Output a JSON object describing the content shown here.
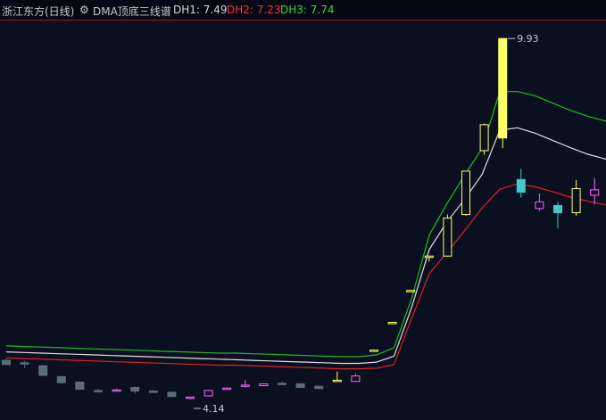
{
  "header": {
    "title": "浙江东方(日线)",
    "gear_icon": "gear-icon",
    "indicator": "DMA顶底三线谱",
    "dh1": "DH1: 7.49",
    "dh2": "DH2: 7.23",
    "dh3": "DH3: 7.74"
  },
  "colors": {
    "background": "#0b1020",
    "up_normal": "#ff66ff",
    "down_normal": "#5a6e78",
    "up_hot": "#ffff66",
    "down_hot": "#44c8c8",
    "dh1_line": "#e0e0e0",
    "dh2_line": "#e02020",
    "dh3_line": "#22bb22"
  },
  "chart_data": {
    "type": "candlestick",
    "ylim": [
      3.6,
      10.2
    ],
    "max_label": "9.93",
    "min_label": "4.14",
    "candles": [
      {
        "o": 4.59,
        "c": 4.52,
        "h": 4.62,
        "l": 4.52,
        "hot": false
      },
      {
        "o": 4.55,
        "c": 4.53,
        "h": 4.58,
        "l": 4.46,
        "hot": false
      },
      {
        "o": 4.5,
        "c": 4.34,
        "h": 4.51,
        "l": 4.33,
        "hot": false
      },
      {
        "o": 4.32,
        "c": 4.22,
        "h": 4.33,
        "l": 4.2,
        "hot": false
      },
      {
        "o": 4.23,
        "c": 4.11,
        "h": 4.24,
        "l": 4.1,
        "hot": false
      },
      {
        "o": 4.09,
        "c": 4.08,
        "h": 4.12,
        "l": 4.07,
        "hot": false
      },
      {
        "o": 4.08,
        "c": 4.1,
        "h": 4.12,
        "l": 4.07,
        "hot": false
      },
      {
        "o": 4.14,
        "c": 4.08,
        "h": 4.16,
        "l": 4.04,
        "hot": false
      },
      {
        "o": 4.08,
        "c": 4.07,
        "h": 4.1,
        "l": 4.05,
        "hot": false
      },
      {
        "o": 4.06,
        "c": 3.99,
        "h": 4.06,
        "l": 3.98,
        "hot": false
      },
      {
        "o": 3.96,
        "c": 3.98,
        "h": 3.98,
        "l": 3.94,
        "hot": false
      },
      {
        "o": 4.0,
        "c": 4.09,
        "h": 4.1,
        "l": 3.99,
        "hot": false
      },
      {
        "o": 4.11,
        "c": 4.13,
        "h": 4.14,
        "l": 4.1,
        "hot": false
      },
      {
        "o": 4.18,
        "c": 4.18,
        "h": 4.26,
        "l": 4.14,
        "hot": false
      },
      {
        "o": 4.17,
        "c": 4.2,
        "h": 4.21,
        "l": 4.16,
        "hot": false
      },
      {
        "o": 4.21,
        "c": 4.2,
        "h": 4.24,
        "l": 4.18,
        "hot": false
      },
      {
        "o": 4.2,
        "c": 4.14,
        "h": 4.21,
        "l": 4.14,
        "hot": false
      },
      {
        "o": 4.16,
        "c": 4.12,
        "h": 4.16,
        "l": 4.12,
        "hot": false
      },
      {
        "o": 4.26,
        "c": 4.26,
        "h": 4.4,
        "l": 4.25,
        "hot": true
      },
      {
        "o": 4.24,
        "c": 4.33,
        "h": 4.37,
        "l": 4.23,
        "hot": false
      },
      {
        "o": 4.76,
        "c": 4.76,
        "h": 4.76,
        "l": 4.76,
        "hot": true
      },
      {
        "o": 5.22,
        "c": 5.22,
        "h": 5.22,
        "l": 5.22,
        "hot": true
      },
      {
        "o": 5.75,
        "c": 5.75,
        "h": 5.75,
        "l": 5.75,
        "hot": true
      },
      {
        "o": 6.32,
        "c": 6.32,
        "h": 6.32,
        "l": 6.23,
        "hot": true
      },
      {
        "o": 6.32,
        "c": 6.95,
        "h": 7.01,
        "l": 6.31,
        "hot": true
      },
      {
        "o": 7.01,
        "c": 7.73,
        "h": 7.73,
        "l": 6.99,
        "hot": true
      },
      {
        "o": 8.07,
        "c": 8.5,
        "h": 8.52,
        "l": 8.0,
        "hot": true
      },
      {
        "o": 8.28,
        "c": 9.93,
        "h": 9.93,
        "l": 8.11,
        "hot": true
      },
      {
        "o": 7.59,
        "c": 7.38,
        "h": 7.77,
        "l": 7.29,
        "hot": false
      },
      {
        "o": 7.11,
        "c": 7.22,
        "h": 7.36,
        "l": 7.07,
        "hot": false
      },
      {
        "o": 7.16,
        "c": 7.04,
        "h": 7.22,
        "l": 6.78,
        "hot": false
      },
      {
        "o": 7.04,
        "c": 7.44,
        "h": 7.58,
        "l": 6.99,
        "hot": true
      },
      {
        "o": 7.33,
        "c": 7.42,
        "h": 7.61,
        "l": 7.18,
        "hot": false
      },
      {
        "o": 7.35,
        "c": 7.35,
        "h": 7.35,
        "l": 7.35,
        "hot": false
      }
    ],
    "lines": {
      "DH3": [
        4.83,
        4.82,
        4.81,
        4.8,
        4.79,
        4.78,
        4.77,
        4.76,
        4.75,
        4.74,
        4.73,
        4.72,
        4.71,
        4.71,
        4.7,
        4.69,
        4.68,
        4.67,
        4.66,
        4.65,
        4.65,
        4.68,
        4.8,
        5.62,
        6.67,
        7.19,
        7.66,
        8.11,
        9.05,
        9.05,
        8.98,
        8.86,
        8.74,
        8.64,
        8.56,
        8.5,
        8.45,
        8.38
      ],
      "DH1": [
        4.73,
        4.72,
        4.71,
        4.7,
        4.69,
        4.68,
        4.67,
        4.66,
        4.65,
        4.64,
        4.63,
        4.62,
        4.61,
        4.6,
        4.59,
        4.58,
        4.57,
        4.56,
        4.55,
        4.54,
        4.54,
        4.56,
        4.66,
        5.47,
        6.43,
        6.89,
        7.26,
        7.68,
        8.41,
        8.45,
        8.36,
        8.24,
        8.12,
        8.01,
        7.93,
        7.87,
        7.83,
        7.8
      ],
      "DH2": [
        4.63,
        4.62,
        4.61,
        4.6,
        4.59,
        4.58,
        4.57,
        4.56,
        4.55,
        4.54,
        4.53,
        4.52,
        4.51,
        4.51,
        4.5,
        4.49,
        4.48,
        4.47,
        4.46,
        4.45,
        4.45,
        4.46,
        4.52,
        5.29,
        6.03,
        6.38,
        6.74,
        7.12,
        7.43,
        7.52,
        7.47,
        7.39,
        7.3,
        7.23,
        7.17,
        7.11,
        7.08,
        7.06
      ]
    }
  }
}
